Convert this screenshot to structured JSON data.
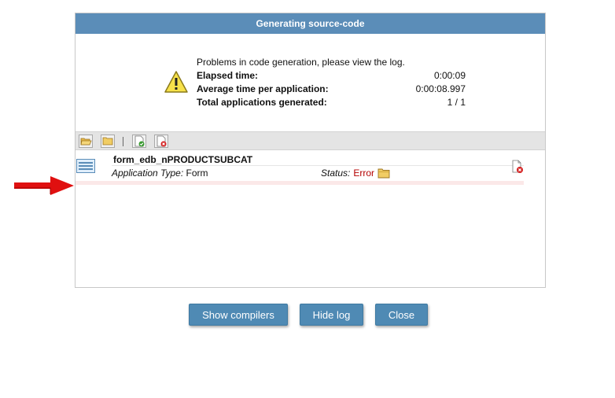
{
  "dialog": {
    "title": "Generating source-code"
  },
  "summary": {
    "message": "Problems in code generation, please view the log.",
    "stats": [
      {
        "label": "Elapsed time:",
        "value": "0:00:09"
      },
      {
        "label": "Average time per application:",
        "value": "0:00:08.997"
      },
      {
        "label": "Total applications generated:",
        "value": "1 / 1"
      }
    ]
  },
  "toolbar": {
    "icons": [
      "open-folder-icon",
      "folder-icon",
      "document-ok-icon",
      "document-error-icon"
    ]
  },
  "log": {
    "app_name": "form_edb_nPRODUCTSUBCAT",
    "type_label": "Application Type:",
    "type_value": "Form",
    "status_label": "Status:",
    "status_value": "Error"
  },
  "buttons": {
    "show_compilers": "Show compilers",
    "hide_log": "Hide log",
    "close": "Close"
  },
  "colors": {
    "title_bar": "#5b8db8",
    "button": "#4f8ab4",
    "error_text": "#b40000",
    "arrow": "#e01010"
  }
}
